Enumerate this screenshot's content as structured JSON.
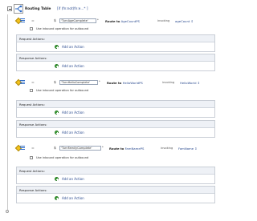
{
  "router": {
    "title": "Routing Table",
    "expression": "[if (fn:not(fn:e...",
    "expression_suffix": "* ]"
  },
  "cases": [
    {
      "operator": "=",
      "dollar": "$",
      "value": "'TurnAgeComplete'",
      "edit_mark": "*",
      "route_prefix": "Route to",
      "route_target": "AgeCountPS",
      "invoking_label": "invoking",
      "operation": "ageCount",
      "outbound_checkbox_label": "Use inbound operation for outbound",
      "outbound_checked": false,
      "request_actions": {
        "header": "Request Actions:",
        "add_label": "Add an Action"
      },
      "response_actions": {
        "header": "Response Actions:",
        "add_label": "Add an Action"
      }
    },
    {
      "operator": "=",
      "dollar": "$",
      "value": "'TurnHelloComplete'",
      "edit_mark": "*",
      "route_prefix": "Route to",
      "route_target": "HelloWorldPS",
      "invoking_label": "invoking",
      "operation": "HelloWorld",
      "outbound_checkbox_label": "Use inbound operation for outbound",
      "outbound_checked": false,
      "request_actions": {
        "header": "Request Actions:",
        "add_label": "Add an Action"
      },
      "response_actions": {
        "header": "Response Actions:",
        "add_label": "Add an Action"
      }
    },
    {
      "operator": "=",
      "dollar": "$",
      "value": "'TurnFamilyComplete'",
      "edit_mark": "*",
      "route_prefix": "Route to",
      "route_target": "FamNamePS",
      "invoking_label": "invoking",
      "operation": "FamName",
      "outbound_checkbox_label": "Use inbound operation for outbound",
      "outbound_checked": false,
      "request_actions": {
        "header": "Request Actions:",
        "add_label": "Add an Action"
      },
      "response_actions": {
        "header": "Response Actions:",
        "add_label": "Add an Action"
      }
    }
  ],
  "colors": {
    "link": "#2a4a8f",
    "add_icon": "#3fa23a",
    "panel_header": "#eef1f6",
    "case_diamond": "#f3c21c",
    "case_bars": "#2e6bc6"
  }
}
